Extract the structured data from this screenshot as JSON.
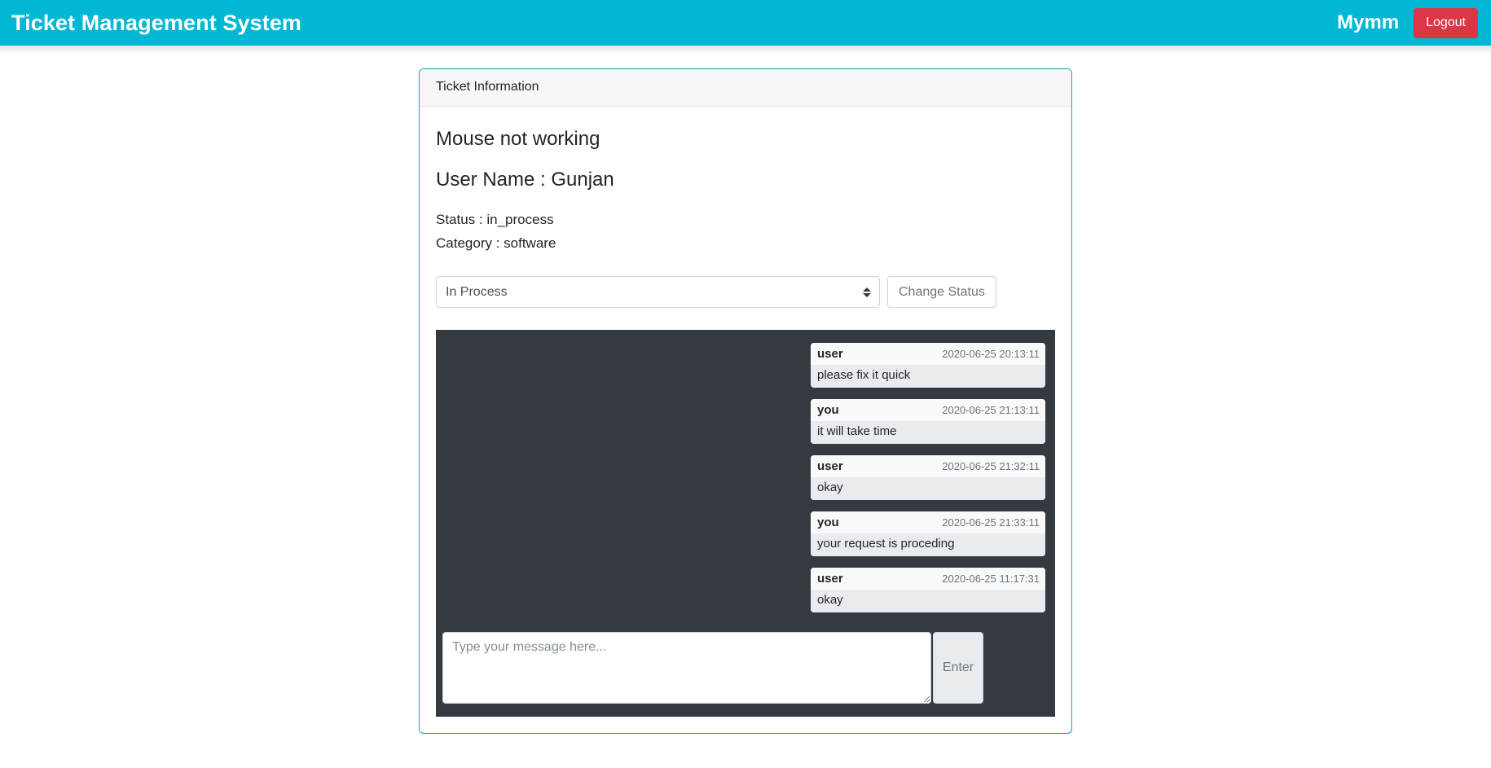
{
  "navbar": {
    "brand": "Ticket Management System",
    "username": "Mymm",
    "logout_label": "Logout",
    "background_color": "#00b8d4",
    "logout_color": "#dc3545"
  },
  "card": {
    "header_title": "Ticket Information",
    "border_color": "#17a2b8",
    "ticket": {
      "title": "Mouse not working",
      "user_line": "User Name : Gunjan",
      "status_line": "Status : in_process",
      "category_line": "Category : software"
    },
    "status_form": {
      "selected_option": "In Process",
      "options": [
        "In Process"
      ],
      "change_button_label": "Change Status",
      "select_arrow_icon": "chevron-updown-icon"
    },
    "chat": {
      "background_color": "#343a40",
      "messages": [
        {
          "sender": "user",
          "timestamp": "2020-06-25 20:13:11",
          "text": "please fix it quick"
        },
        {
          "sender": "you",
          "timestamp": "2020-06-25 21:13:11",
          "text": "it will take time"
        },
        {
          "sender": "user",
          "timestamp": "2020-06-25 21:32:11",
          "text": "okay"
        },
        {
          "sender": "you",
          "timestamp": "2020-06-25 21:33:11",
          "text": "your request is proceding"
        },
        {
          "sender": "user",
          "timestamp": "2020-06-25 11:17:31",
          "text": "okay"
        }
      ],
      "composer": {
        "placeholder": "Type your message here...",
        "value": "",
        "send_label": "Enter"
      }
    }
  }
}
